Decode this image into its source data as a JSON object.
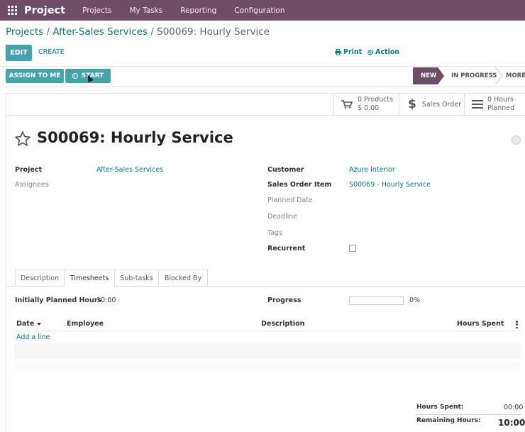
{
  "navbar": {
    "app_name": "Project",
    "menu": [
      "Projects",
      "My Tasks",
      "Reporting",
      "Configuration"
    ],
    "bg_color": "#6e4d67"
  },
  "breadcrumb": {
    "root": "Projects",
    "sep1": "/",
    "parent": "After-Sales Services",
    "sep2": "/",
    "current": "S00069: Hourly Service"
  },
  "controls": {
    "edit": "EDIT",
    "create": "CREATE",
    "print": "Print",
    "action": "Action"
  },
  "header_buttons": {
    "assign_to_me": "ASSIGN TO ME",
    "start": "START"
  },
  "stages": {
    "new": "NEW",
    "in_progress": "IN PROGRESS",
    "more": "MORE",
    "active_color": "#6e4d67"
  },
  "smart_buttons": {
    "products_count": "0 Products",
    "products_amount": "$ 0.00",
    "sales_order": "Sales Order",
    "hours_value": "0  Hours",
    "hours_label": "Planned"
  },
  "task": {
    "title": "S00069: Hourly Service"
  },
  "fields_left": {
    "project_label": "Project",
    "project_value": "After-Sales Services",
    "assignees_label": "Assignees"
  },
  "fields_right": {
    "customer_label": "Customer",
    "customer_value": "Azure Interior",
    "sales_order_item_label": "Sales Order Item",
    "sales_order_item_value": "S00069 - Hourly Service",
    "planned_date_label": "Planned Date",
    "deadline_label": "Deadline",
    "tags_label": "Tags",
    "recurrent_label": "Recurrent"
  },
  "tabs": [
    "Description",
    "Timesheets",
    "Sub-tasks",
    "Blocked By"
  ],
  "timesheets": {
    "initially_planned_label": "Initially Planned Hours",
    "initially_planned_value": "10:00",
    "progress_label": "Progress",
    "progress_value": "0%",
    "progress_fraction": 0,
    "columns": [
      "Date",
      "Employee",
      "Description",
      "Hours Spent"
    ],
    "add_line": "Add a line",
    "hours_spent_label": "Hours Spent:",
    "hours_spent_value": "00:00",
    "remaining_label": "Remaining Hours:",
    "remaining_value": "10:00"
  }
}
